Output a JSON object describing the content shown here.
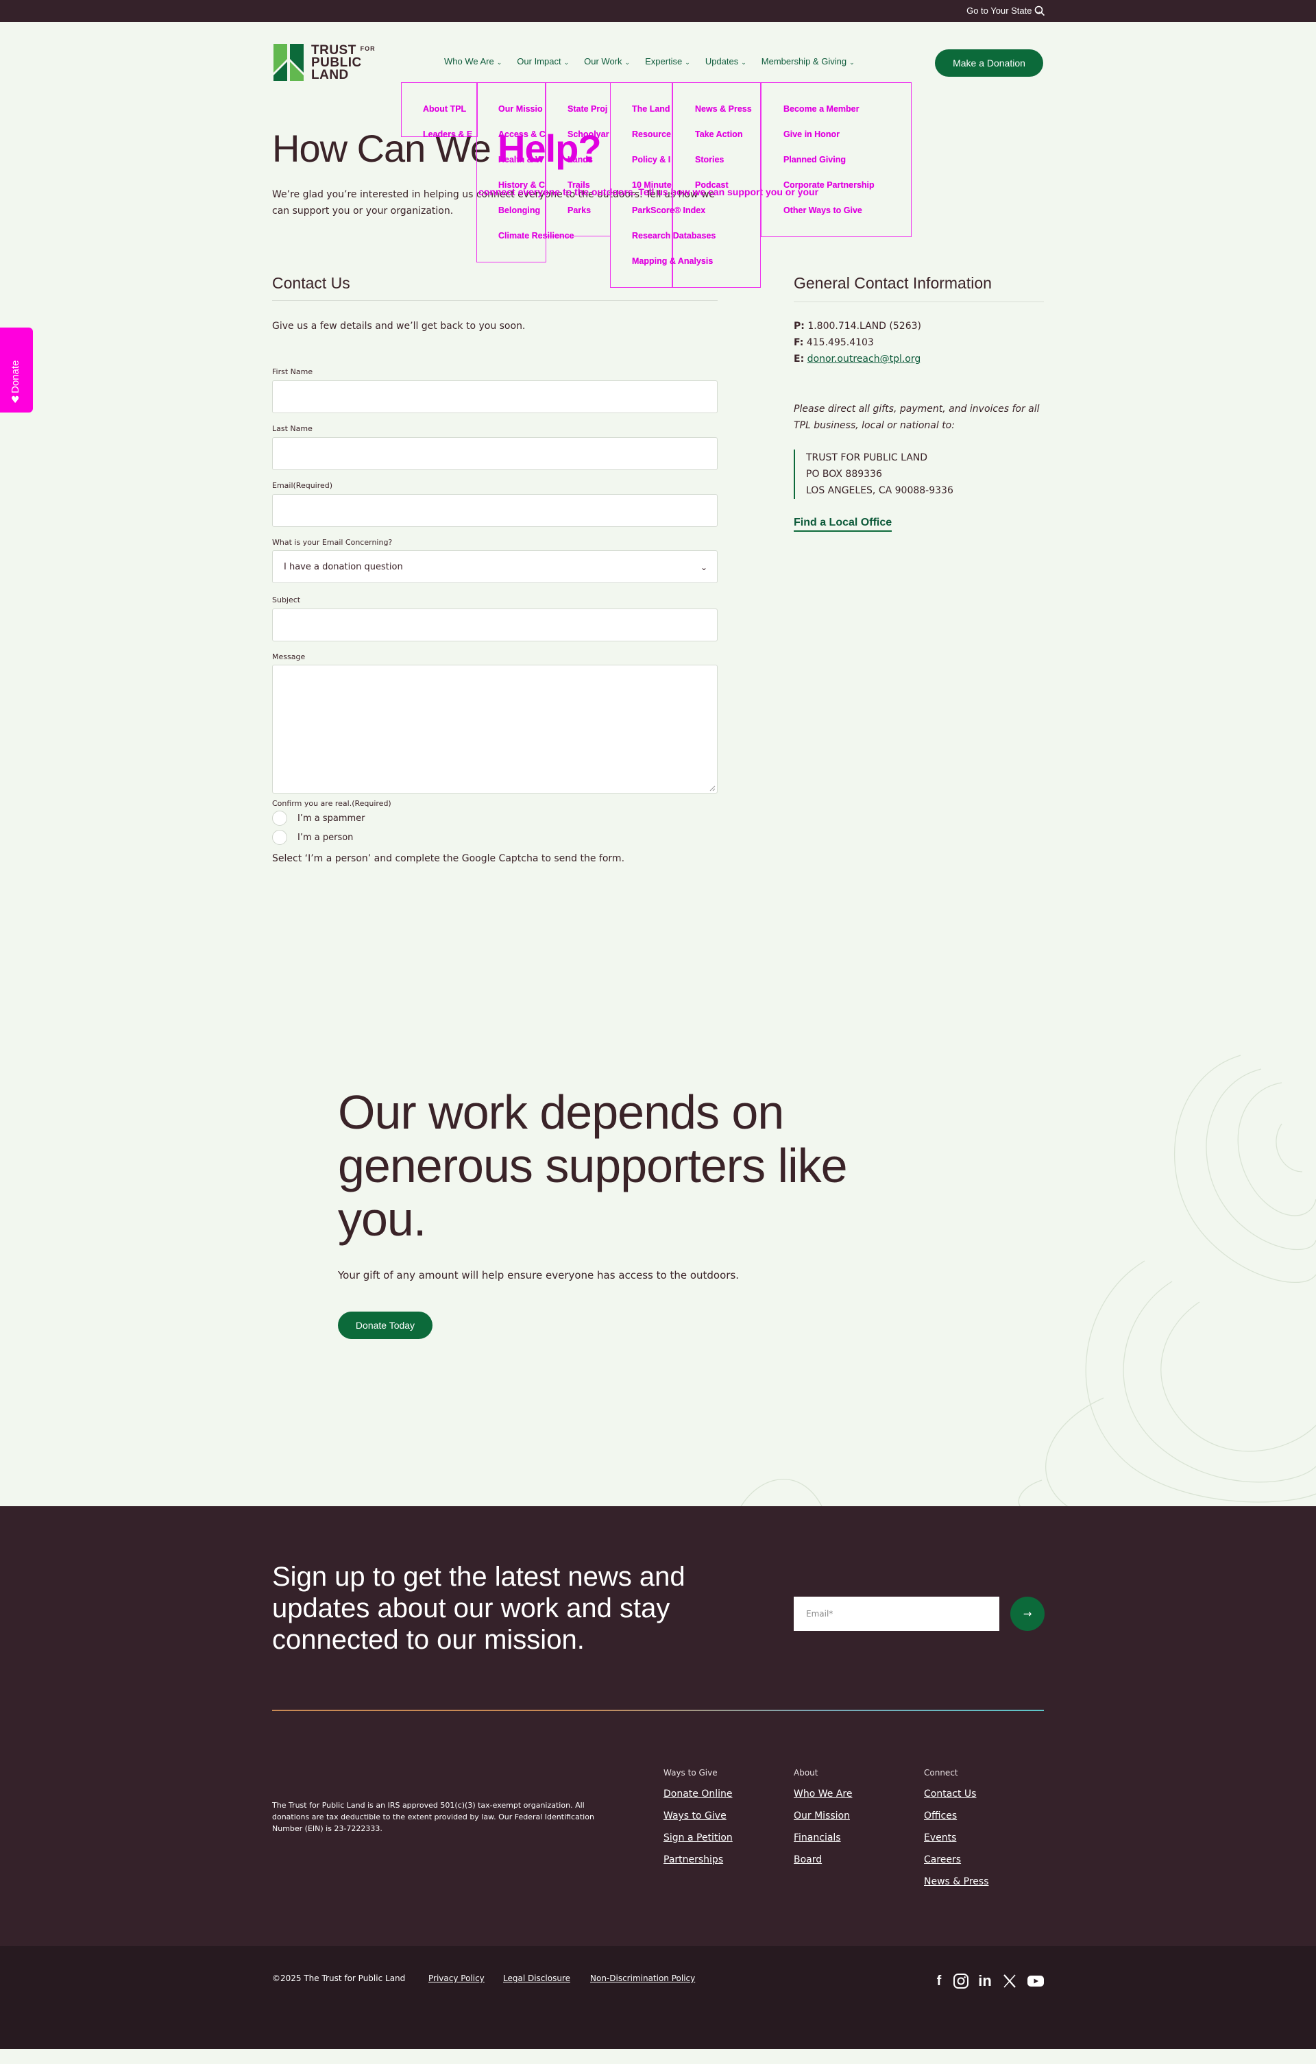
{
  "topbar": {
    "state_label": "Go to Your State ⌄",
    "search_icon": "search-icon"
  },
  "logo": {
    "line1": "TRUST",
    "line1_small": "FOR",
    "line2": "PUBLIC",
    "line3": "LAND"
  },
  "nav": [
    {
      "label": "Who We Are"
    },
    {
      "label": "Our Impact"
    },
    {
      "label": "Our Work"
    },
    {
      "label": "Expertise"
    },
    {
      "label": "Updates"
    },
    {
      "label": "Membership & Giving"
    }
  ],
  "donate_button": "Make a Donation",
  "overlay_menus": {
    "col1": [
      "About TPL",
      "Leaders & E"
    ],
    "col2": [
      "Our Missio",
      "Access & C",
      "Health & W",
      "History & C",
      "Belonging",
      "Climate Resilience"
    ],
    "col3": [
      "State Proj",
      "Schoolyar",
      "Lands",
      "Trails",
      "Parks"
    ],
    "col4": [
      "The Land",
      "Resource",
      "Policy & I",
      "10 Minute",
      "ParkScore® Index",
      "Research Databases",
      "Mapping & Analysis"
    ],
    "col5": [
      "News & Press",
      "Take Action",
      "Stories",
      "Podcast"
    ],
    "col6": [
      "Become a Member",
      "Give in Honor",
      "Planned Giving",
      "Corporate Partnership",
      "Other Ways to Give"
    ]
  },
  "hero": {
    "title": "How Can We",
    "title_overlay": "Help?",
    "intro": "We’re glad you’re interested in helping us connect everyone to the outdoors. Tell us how we can support you or your organization.",
    "intro_overlay": "connect everyone to the outdoors. Tell us how we can support you or your"
  },
  "side_tab": {
    "label": "Donate",
    "icon": "heart-icon"
  },
  "contact_form": {
    "title": "Contact Us",
    "subtitle": "Give us a few details and we’ll get back to you soon.",
    "first_name_label": "First Name",
    "last_name_label": "Last Name",
    "email_label": "Email(Required)",
    "concern_label": "What is your Email Concerning?",
    "concern_value": "I have a donation question",
    "subject_label": "Subject",
    "message_label": "Message",
    "confirm_label": "Confirm you are real.(Required)",
    "radio1": "I’m a spammer",
    "radio2": "I’m a person",
    "captcha_note": "Select ‘I’m a person’ and complete the Google Captcha to send the form."
  },
  "general_info": {
    "title": "General Contact Information",
    "phone_label": "P:",
    "phone": "1.800.714.LAND (5263)",
    "fax_label": "F:",
    "fax": "415.495.4103",
    "email_label": "E:",
    "email": "donor.outreach@tpl.org",
    "note": "Please direct all gifts, payment, and invoices for all TPL business, local or national to:",
    "addr1": "TRUST FOR PUBLIC LAND",
    "addr2": "PO BOX 889336",
    "addr3": "LOS ANGELES, CA 90088-9336",
    "find_office": "Find a Local Office"
  },
  "support": {
    "title": "Our work depends on generous supporters like you.",
    "text": "Your gift of any amount will help ensure everyone has access to the outdoors.",
    "button": "Donate Today"
  },
  "newsletter": {
    "title": "Sign up to get the latest news and updates about our work and stay connected to our mission.",
    "email_placeholder": "Email*",
    "submit_icon": "arrow-right-icon"
  },
  "footer": {
    "tax_text": "The Trust for Public Land is an IRS approved 501(c)(3) tax-exempt organization. All donations are tax deductible to the extent provided by law. Our Federal Identification Number (EIN) is 23-7222333.",
    "cols": [
      {
        "heading": "Ways to Give",
        "links": [
          "Donate Online",
          "Ways to Give",
          "Sign a Petition",
          "Partnerships"
        ]
      },
      {
        "heading": "About",
        "links": [
          "Who We Are",
          "Our Mission",
          "Financials",
          "Board"
        ]
      },
      {
        "heading": "Connect",
        "links": [
          "Contact Us",
          "Offices",
          "Events",
          "Careers",
          "News & Press"
        ]
      }
    ],
    "copyright": "©2025 The Trust for Public Land",
    "legal": [
      "Privacy Policy",
      "Legal Disclosure",
      "Non-Discrimination Policy"
    ],
    "social": [
      "facebook-icon",
      "instagram-icon",
      "linkedin-icon",
      "x-icon",
      "youtube-icon"
    ]
  },
  "colors": {
    "brand_green": "#0c6a3a",
    "dark_plum": "#35222a",
    "background": "#f2f7ef",
    "overlay_magenta": "#e000e0"
  }
}
